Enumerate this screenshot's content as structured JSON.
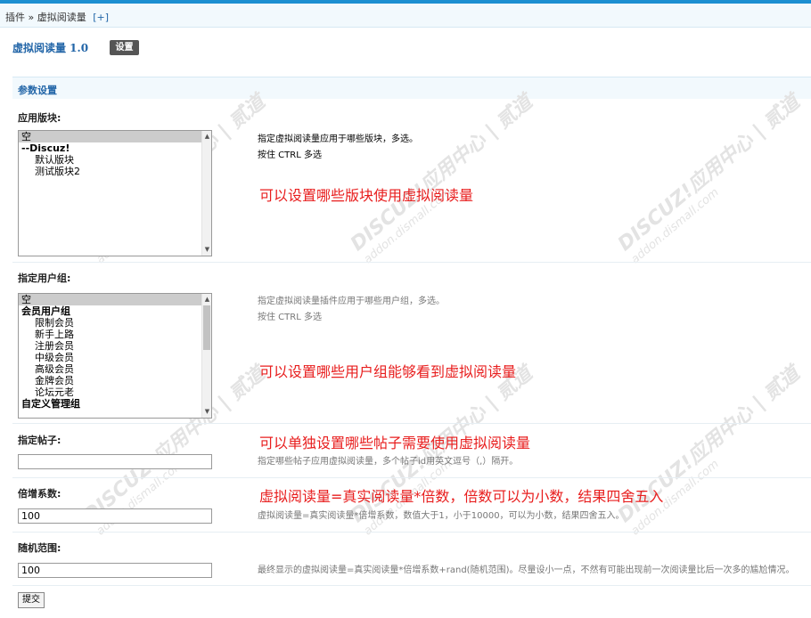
{
  "breadcrumb": {
    "plugins": "插件",
    "separator": "»",
    "current": "虚拟阅读量",
    "add": "[+]"
  },
  "plugin": {
    "title": "虚拟阅读量 1.0",
    "settings_button": "设置"
  },
  "section": {
    "title": "参数设置"
  },
  "watermark": {
    "text": "DISCUZ!应用中心 | 贰道",
    "url": "addon.dismall.com"
  },
  "fields": {
    "forums": {
      "label": "应用版块:",
      "options": [
        "空",
        "--Discuz!",
        "默认版块",
        "测试版块2"
      ],
      "desc1": "指定虚拟阅读量应用于哪些版块，多选。",
      "desc2": "按住 CTRL 多选",
      "annotation": "可以设置哪些版块使用虚拟阅读量"
    },
    "groups": {
      "label": "指定用户组:",
      "options": [
        "空",
        "会员用户组",
        "限制会员",
        "新手上路",
        "注册会员",
        "中级会员",
        "高级会员",
        "金牌会员",
        "论坛元老",
        "自定义管理组"
      ],
      "desc1": "指定虚拟阅读量插件应用于哪些用户组，多选。",
      "desc2": "按住 CTRL 多选",
      "annotation": "可以设置哪些用户组能够看到虚拟阅读量"
    },
    "threads": {
      "label": "指定帖子:",
      "value": "",
      "desc": "指定哪些帖子应用虚拟阅读量，多个帖子id用英文逗号（,）隔开。",
      "annotation": "可以单独设置哪些帖子需要使用虚拟阅读量"
    },
    "multiplier": {
      "label": "倍增系数:",
      "value": "100",
      "desc": "虚拟阅读量=真实阅读量*倍增系数，数值大于1，小于10000，可以为小数，结果四舍五入。",
      "annotation": "虚拟阅读量=真实阅读量*倍数，倍数可以为小数，结果四舍五入"
    },
    "random": {
      "label": "随机范围:",
      "value": "100",
      "desc": "最终显示的虚拟阅读量=真实阅读量*倍增系数+rand(随机范围)。尽量设小一点，不然有可能出现前一次阅读量比后一次多的尴尬情况。"
    }
  },
  "submit_label": "提交"
}
